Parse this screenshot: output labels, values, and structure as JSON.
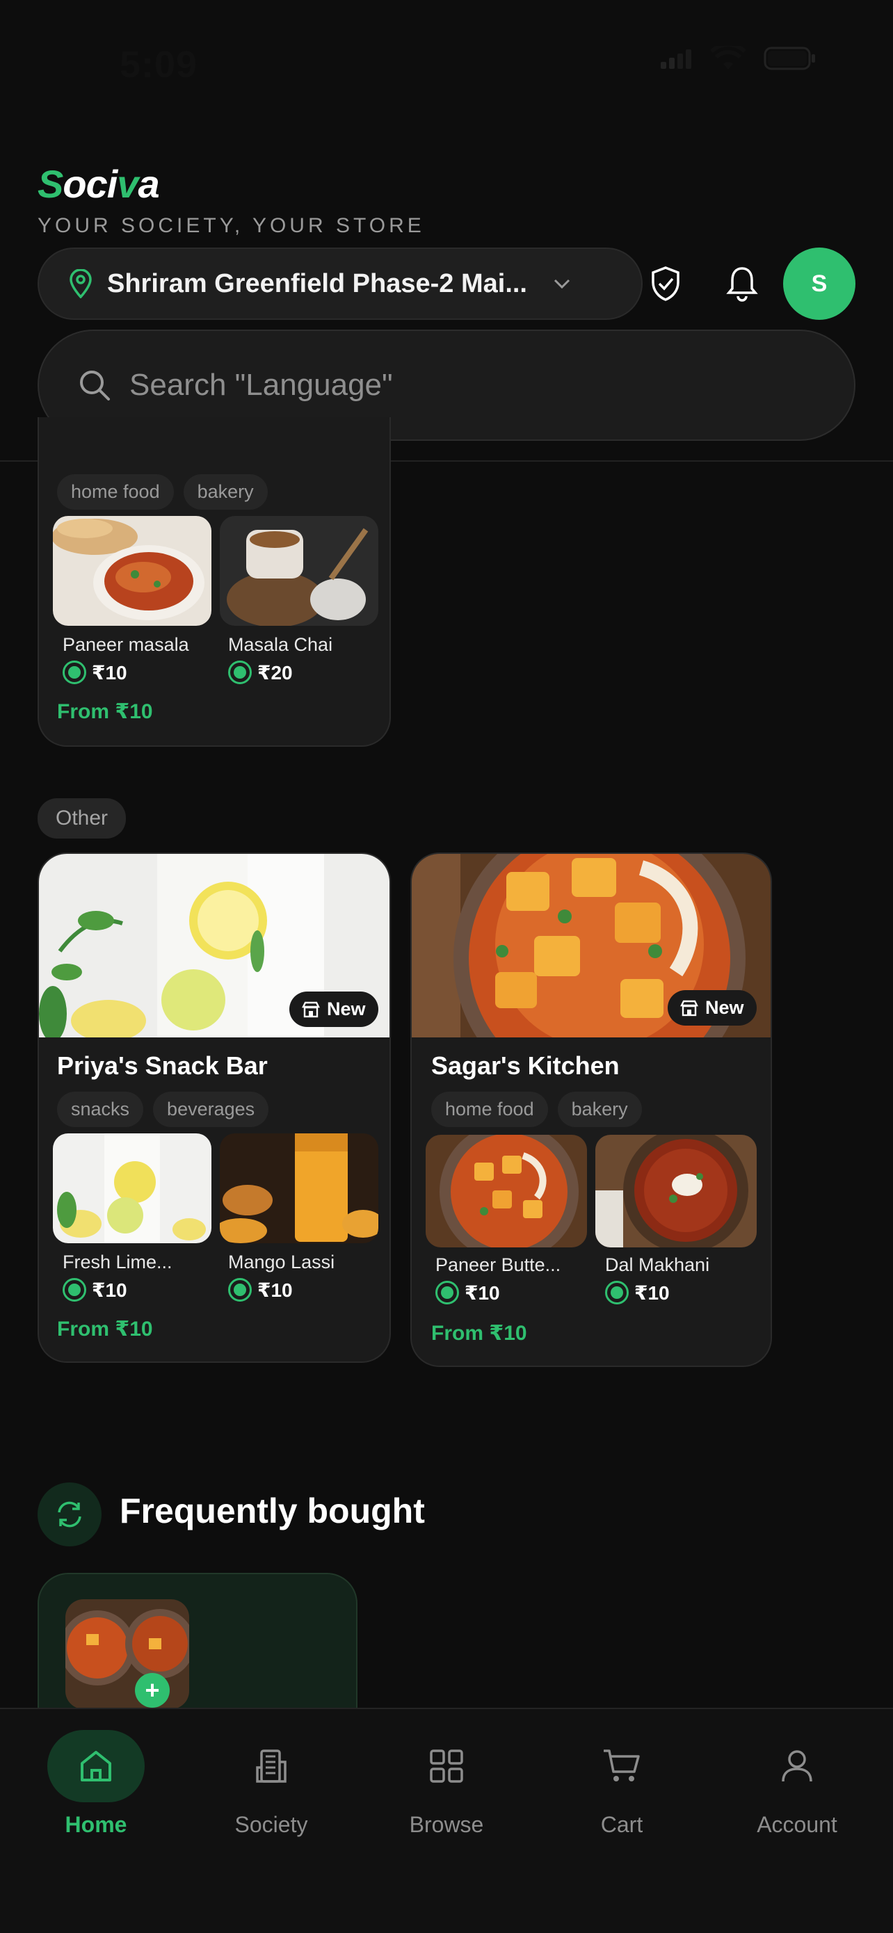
{
  "status_bar": {
    "time": "5:09"
  },
  "header": {
    "logo": {
      "part1": "S",
      "part2": "oci",
      "part3": "v",
      "part4": "a"
    },
    "tagline": "YOUR SOCIETY, YOUR STORE",
    "location": "Shriram Greenfield Phase-2 Mai...",
    "avatar_initial": "S"
  },
  "search": {
    "placeholder": "Search \"Language\""
  },
  "partial_card": {
    "tags": [
      "home food",
      "bakery"
    ],
    "items": [
      {
        "name": "Paneer masala",
        "price": "₹10"
      },
      {
        "name": "Masala Chai",
        "price": "₹20"
      }
    ],
    "from": "From ₹10"
  },
  "section": {
    "label": "Other"
  },
  "stores": [
    {
      "badge": "New",
      "name": "Priya's Snack Bar",
      "tags": [
        "snacks",
        "beverages"
      ],
      "items": [
        {
          "name": "Fresh Lime...",
          "price": "₹10"
        },
        {
          "name": "Mango Lassi",
          "price": "₹10"
        }
      ],
      "from": "From ₹10"
    },
    {
      "badge": "New",
      "name": "Sagar's Kitchen",
      "tags": [
        "home food",
        "bakery"
      ],
      "items": [
        {
          "name": "Paneer Butte...",
          "price": "₹10"
        },
        {
          "name": "Dal Makhani",
          "price": "₹10"
        }
      ],
      "from": "From ₹10"
    }
  ],
  "frequently_bought": {
    "title": "Frequently bought",
    "add_symbol": "+"
  },
  "tabbar": {
    "tabs": [
      {
        "label": "Home",
        "icon": "home-icon"
      },
      {
        "label": "Society",
        "icon": "building-icon"
      },
      {
        "label": "Browse",
        "icon": "grid-icon"
      },
      {
        "label": "Cart",
        "icon": "cart-icon"
      },
      {
        "label": "Account",
        "icon": "user-icon"
      }
    ]
  },
  "colors": {
    "accent": "#2fbf6f",
    "background": "#0d0d0d"
  }
}
